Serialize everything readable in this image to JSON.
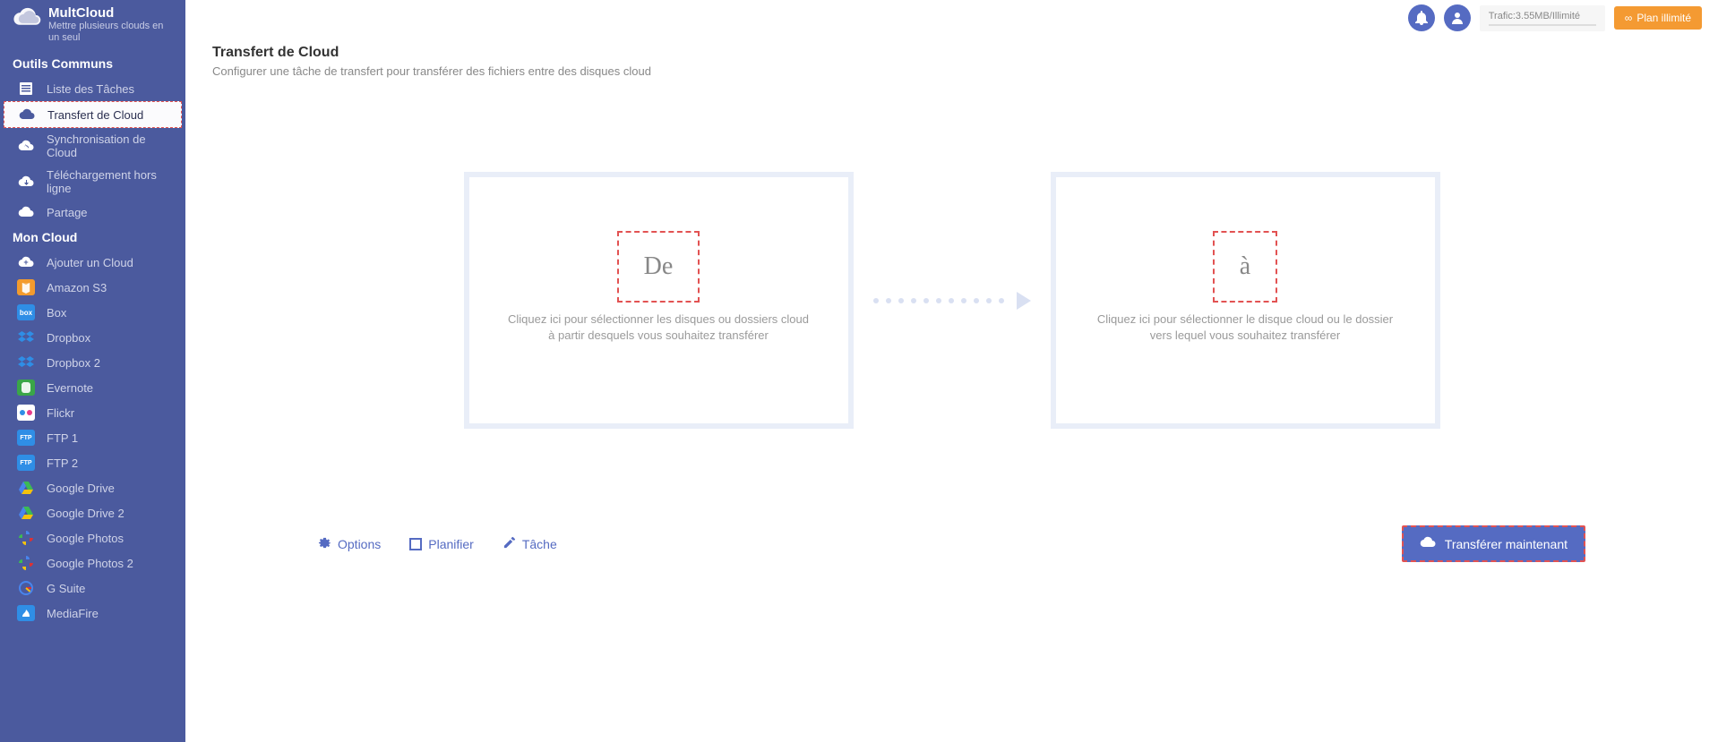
{
  "brand": {
    "title": "MultCloud",
    "subtitle": "Mettre plusieurs clouds en un seul"
  },
  "sidebar": {
    "section_common": "Outils Communs",
    "common": [
      {
        "label": "Liste des Tâches",
        "icon": "list-icon"
      },
      {
        "label": "Transfert de Cloud",
        "icon": "cloud-transfer-icon",
        "active": true
      },
      {
        "label": "Synchronisation de Cloud",
        "icon": "cloud-sync-icon"
      },
      {
        "label": "Téléchargement hors ligne",
        "icon": "cloud-download-icon"
      },
      {
        "label": "Partage",
        "icon": "share-icon"
      }
    ],
    "section_mycloud": "Mon Cloud",
    "clouds": [
      {
        "label": "Ajouter un Cloud",
        "icon_bg": "transparent",
        "icon_txt": "+"
      },
      {
        "label": "Amazon S3",
        "icon_bg": "#f39b2d",
        "icon_txt": ""
      },
      {
        "label": "Box",
        "icon_bg": "#2f8ee6",
        "icon_txt": "box"
      },
      {
        "label": "Dropbox",
        "icon_bg": "transparent",
        "icon_txt": ""
      },
      {
        "label": "Dropbox 2",
        "icon_bg": "transparent",
        "icon_txt": ""
      },
      {
        "label": "Evernote",
        "icon_bg": "#3aa648",
        "icon_txt": ""
      },
      {
        "label": "Flickr",
        "icon_bg": "#ffffff",
        "icon_txt": ""
      },
      {
        "label": "FTP 1",
        "icon_bg": "#2f8ee6",
        "icon_txt": "FTP"
      },
      {
        "label": "FTP 2",
        "icon_bg": "#2f8ee6",
        "icon_txt": "FTP"
      },
      {
        "label": "Google Drive",
        "icon_bg": "transparent",
        "icon_txt": ""
      },
      {
        "label": "Google Drive 2",
        "icon_bg": "transparent",
        "icon_txt": ""
      },
      {
        "label": "Google Photos",
        "icon_bg": "transparent",
        "icon_txt": ""
      },
      {
        "label": "Google Photos 2",
        "icon_bg": "transparent",
        "icon_txt": ""
      },
      {
        "label": "G Suite",
        "icon_bg": "transparent",
        "icon_txt": ""
      },
      {
        "label": "MediaFire",
        "icon_bg": "#2f8ee6",
        "icon_txt": ""
      }
    ]
  },
  "topbar": {
    "traffic": "Trafic:3.55MB/Illimité",
    "plan_button": "Plan illimité"
  },
  "page": {
    "title": "Transfert de Cloud",
    "subtitle": "Configurer une tâche de transfert pour transférer des fichiers entre des disques cloud"
  },
  "source": {
    "label": "De",
    "desc": "Cliquez ici pour sélectionner les disques ou dossiers cloud à partir desquels vous souhaitez transférer"
  },
  "dest": {
    "label": "à",
    "desc": "Cliquez ici pour sélectionner le disque cloud ou le dossier vers lequel vous souhaitez transférer"
  },
  "actions": {
    "options": "Options",
    "schedule": "Planifier",
    "task": "Tâche",
    "transfer_now": "Transférer maintenant"
  }
}
